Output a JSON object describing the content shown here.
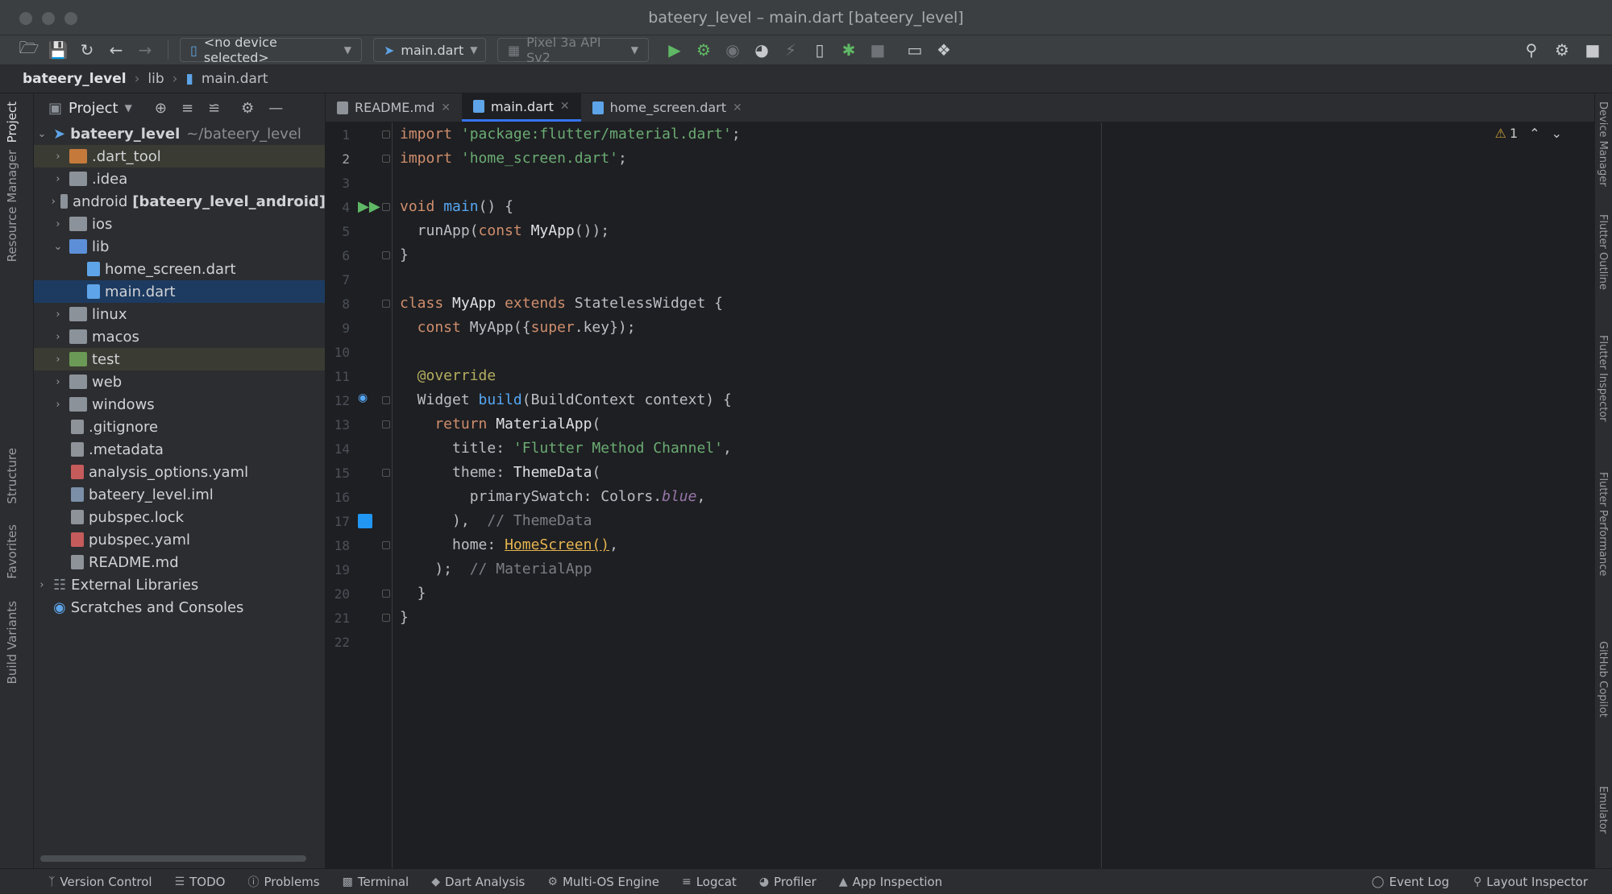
{
  "window": {
    "title": "bateery_level – main.dart [bateery_level]"
  },
  "toolbar": {
    "device_combo": "<no device selected>",
    "run_config": "main.dart",
    "emulator": "Pixel 3a API Sv2"
  },
  "breadcrumb": {
    "project": "bateery_level",
    "dir": "lib",
    "file": "main.dart"
  },
  "left_stripe": {
    "project": "Project",
    "resource_manager": "Resource Manager",
    "structure": "Structure",
    "favorites": "Favorites",
    "build_variants": "Build Variants"
  },
  "project_panel": {
    "title": "Project",
    "root_name": "bateery_level",
    "root_path": "~/bateery_level",
    "items": [
      {
        "label": ".dart_tool"
      },
      {
        "label": ".idea"
      },
      {
        "label": "android",
        "extra": "[bateery_level_android]"
      },
      {
        "label": "ios"
      },
      {
        "label": "lib"
      },
      {
        "label": "home_screen.dart"
      },
      {
        "label": "main.dart"
      },
      {
        "label": "linux"
      },
      {
        "label": "macos"
      },
      {
        "label": "test"
      },
      {
        "label": "web"
      },
      {
        "label": "windows"
      },
      {
        "label": ".gitignore"
      },
      {
        "label": ".metadata"
      },
      {
        "label": "analysis_options.yaml"
      },
      {
        "label": "bateery_level.iml"
      },
      {
        "label": "pubspec.lock"
      },
      {
        "label": "pubspec.yaml"
      },
      {
        "label": "README.md"
      },
      {
        "label": "External Libraries"
      },
      {
        "label": "Scratches and Consoles"
      }
    ]
  },
  "tabs": [
    {
      "label": "README.md"
    },
    {
      "label": "main.dart"
    },
    {
      "label": "home_screen.dart"
    }
  ],
  "editor": {
    "warning_count": "1",
    "line_numbers": [
      "1",
      "2",
      "3",
      "4",
      "5",
      "6",
      "7",
      "8",
      "9",
      "10",
      "11",
      "12",
      "13",
      "14",
      "15",
      "16",
      "17",
      "18",
      "19",
      "20",
      "21",
      "22"
    ],
    "code": {
      "l1_kw": "import",
      "l1_str": "'package:flutter/material.dart'",
      "l1_end": ";",
      "l2_kw": "import",
      "l2_str": "'home_screen.dart'",
      "l2_end": ";",
      "l4_kw": "void",
      "l4_fn": "main",
      "l4_end": "() {",
      "l5_a": "  runApp(",
      "l5_kw": "const",
      "l5_cls": "MyApp",
      "l5_end": "());",
      "l6": "}",
      "l8_kw": "class",
      "l8_cls": "MyApp",
      "l8_kw2": "extends",
      "l8_end": "StatelessWidget {",
      "l9_kw": "  const",
      "l9_a": "MyApp({",
      "l9_kw2": "super",
      "l9_end": ".key});",
      "l11": "  @override",
      "l12_a": "  Widget",
      "l12_fn": "build",
      "l12_end": "(BuildContext context) {",
      "l13_kw": "    return",
      "l13_cls": "MaterialApp",
      "l13_end": "(",
      "l14_a": "      title:",
      "l14_str": "'Flutter Method Channel'",
      "l14_end": ",",
      "l15_a": "      theme:",
      "l15_cls": "ThemeData",
      "l15_end": "(",
      "l16_a": "        primarySwatch: Colors.",
      "l16_it": "blue",
      "l16_end": ",",
      "l17_a": "      ),",
      "l17_cmt": "// ThemeData",
      "l18_a": "      home:",
      "l18_u": "HomeScreen()",
      "l18_end": ",",
      "l19_a": "    );",
      "l19_cmt": "// MaterialApp",
      "l20": "  }",
      "l21": "}"
    }
  },
  "right_stripe": [
    "Device Manager",
    "Flutter Outline",
    "Flutter Inspector",
    "Flutter Performance",
    "GitHub Copilot",
    "Emulator"
  ],
  "statusbar": {
    "items": [
      "Version Control",
      "TODO",
      "Problems",
      "Terminal",
      "Dart Analysis",
      "Multi-OS Engine",
      "Logcat",
      "Profiler",
      "App Inspection"
    ],
    "right": [
      "Event Log",
      "Layout Inspector"
    ]
  },
  "colors": {
    "accent": "#3574f0",
    "selection": "#1d3b61",
    "swatch_blue": "#2196f3"
  }
}
